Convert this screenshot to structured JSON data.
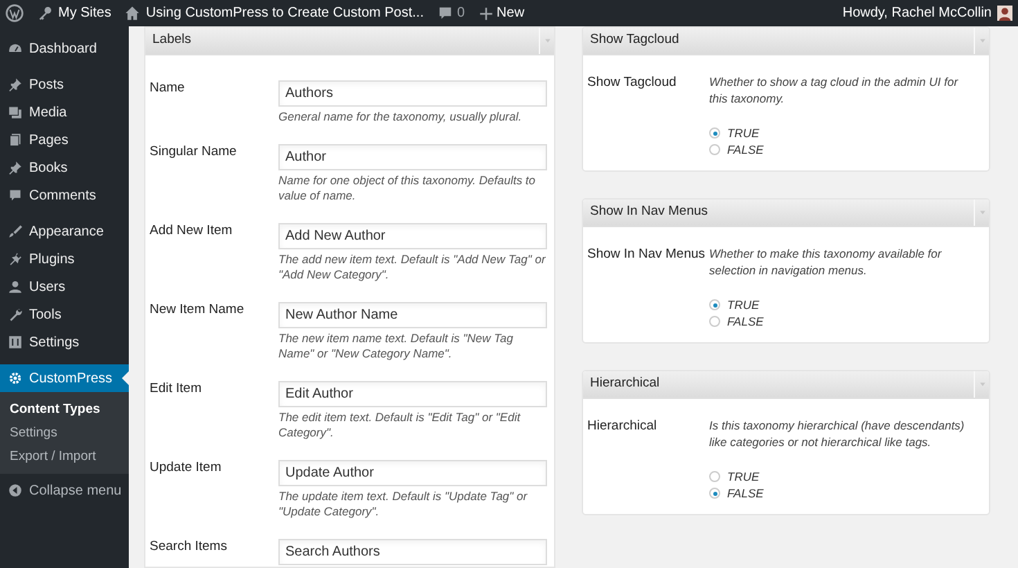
{
  "admin_bar": {
    "site_menu": "My Sites",
    "page_link": "Using CustomPress to Create Custom Post...",
    "comments_count": "0",
    "new_link": "New",
    "greeting": "Howdy, Rachel McCollin"
  },
  "sidebar": {
    "groups": [
      {
        "items": [
          {
            "label": "Dashboard",
            "selected": false
          }
        ]
      },
      {
        "items": [
          {
            "label": "Posts",
            "selected": false
          },
          {
            "label": "Media",
            "selected": false
          },
          {
            "label": "Pages",
            "selected": false
          },
          {
            "label": "Books",
            "selected": false
          },
          {
            "label": "Comments",
            "selected": false
          }
        ]
      },
      {
        "items": [
          {
            "label": "Appearance",
            "selected": false
          },
          {
            "label": "Plugins",
            "selected": false
          },
          {
            "label": "Users",
            "selected": false
          },
          {
            "label": "Tools",
            "selected": false
          },
          {
            "label": "Settings",
            "selected": false
          }
        ]
      },
      {
        "items": [
          {
            "label": "CustomPress",
            "selected": true,
            "children": [
              {
                "label": "Content Types",
                "selected": true
              },
              {
                "label": "Settings",
                "selected": false
              },
              {
                "label": "Export / Import",
                "selected": false
              }
            ]
          }
        ]
      }
    ],
    "collapse_menu": "Collapse menu"
  },
  "labels_panel": {
    "title": "Labels",
    "fields": [
      {
        "label": "Name",
        "value": "Authors",
        "hint": "General name for the taxonomy, usually plural."
      },
      {
        "label": "Singular Name",
        "value": "Author",
        "hint": "Name for one object of this taxonomy. Defaults to value of name."
      },
      {
        "label": "Add New Item",
        "value": "Add New Author",
        "hint": "The add new item text. Default is \"Add New Tag\" or \"Add New Category\"."
      },
      {
        "label": "New Item Name",
        "value": "New Author Name",
        "hint": "The new item name text. Default is \"New Tag Name\" or \"New Category Name\"."
      },
      {
        "label": "Edit Item",
        "value": "Edit Author",
        "hint": "The edit item text. Default is \"Edit Tag\" or \"Edit Category\"."
      },
      {
        "label": "Update Item",
        "value": "Update Author",
        "hint": "The update item text. Default is \"Update Tag\" or \"Update Category\"."
      },
      {
        "label": "Search Items",
        "value": "Search Authors"
      }
    ]
  },
  "settings_panels": [
    {
      "title": "Show Tagcloud",
      "label": "Show Tagcloud",
      "description": "Whether to show a tag cloud in the admin UI for this taxonomy.",
      "options": [
        {
          "label": "TRUE",
          "selected": true
        },
        {
          "label": "FALSE",
          "selected": false
        }
      ]
    },
    {
      "title": "Show In Nav Menus",
      "label": "Show In Nav Menus",
      "description": "Whether to make this taxonomy available for selection in navigation menus.",
      "options": [
        {
          "label": "TRUE",
          "selected": true
        },
        {
          "label": "FALSE",
          "selected": false
        }
      ]
    },
    {
      "title": "Hierarchical",
      "label": "Hierarchical",
      "description": "Is this taxonomy hierarchical (have descendants) like categories or not hierarchical like tags.",
      "options": [
        {
          "label": "TRUE",
          "selected": false
        },
        {
          "label": "FALSE",
          "selected": true
        }
      ]
    }
  ]
}
